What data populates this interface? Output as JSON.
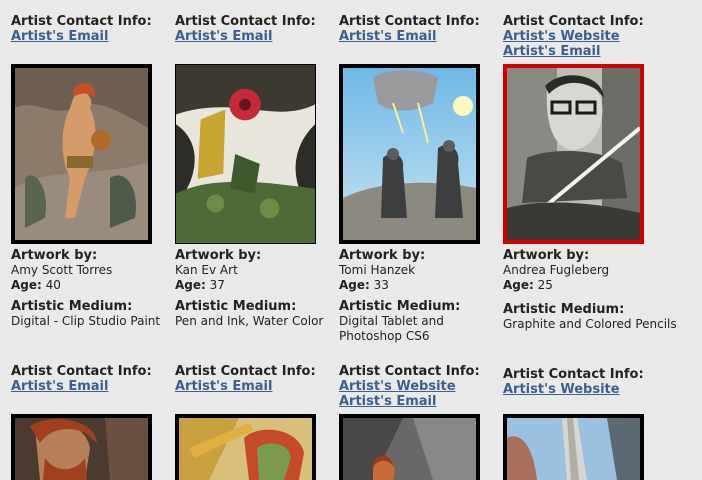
{
  "labels": {
    "contact": "Artist Contact Info:",
    "artwork_by": "Artwork by:",
    "age": "Age:",
    "medium": "Artistic Medium:"
  },
  "row1": [
    {
      "links": [
        "Artist's Email"
      ],
      "artist": "Amy Scott Torres",
      "age": "40",
      "medium": [
        "Digital - Clip Studio Paint"
      ]
    },
    {
      "links": [
        "Artist's Email"
      ],
      "artist": "Kan Ev Art",
      "age": "37",
      "medium": [
        "Pen and Ink, Water Color"
      ]
    },
    {
      "links": [
        "Artist's Email"
      ],
      "artist": "Tomi Hanzek",
      "age": "33",
      "medium": [
        "Digital Tablet and",
        "Photoshop CS6"
      ]
    },
    {
      "links": [
        "Artist's Website",
        "Artist's Email"
      ],
      "artist": "Andrea Fugleberg",
      "age": "25",
      "medium": [
        "Graphite and Colored Pencils"
      ]
    }
  ],
  "row2": [
    {
      "links": [
        "Artist's Email"
      ]
    },
    {
      "links": [
        "Artist's Email"
      ]
    },
    {
      "links": [
        "Artist's Website",
        "Artist's Email"
      ]
    },
    {
      "links": [
        "Artist's Website"
      ]
    }
  ],
  "colors": {
    "link": "#3d5f8c",
    "highlight_border": "#d10000",
    "background": "#e9e9e9"
  }
}
